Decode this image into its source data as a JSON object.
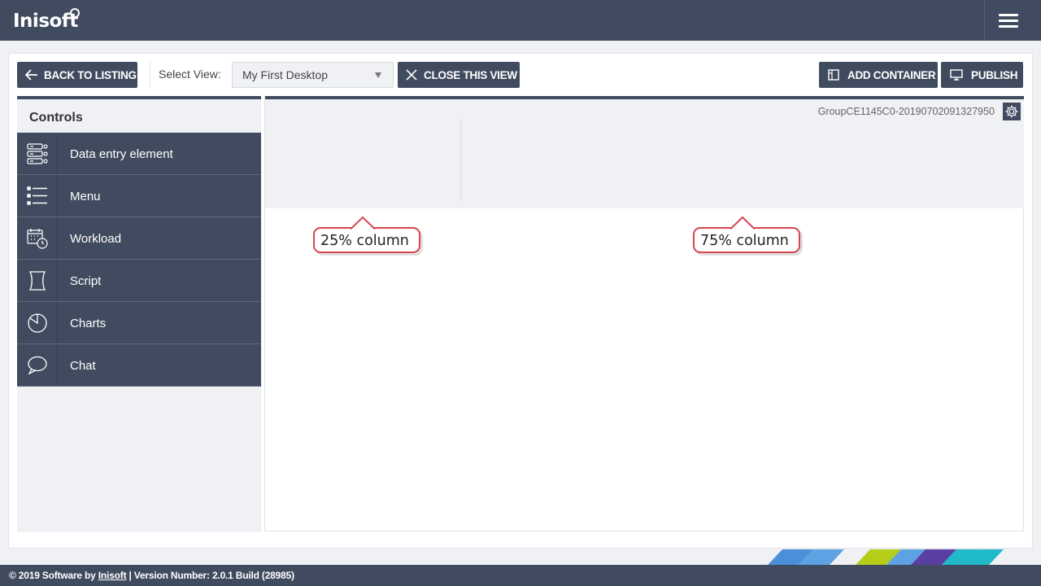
{
  "app": {
    "logo_text": "Inisoft"
  },
  "toolbar": {
    "back_label": "BACK TO LISTING",
    "select_label": "Select View:",
    "select_value": "My First Desktop",
    "close_label": "CLOSE THIS VIEW",
    "add_container_label": "ADD CONTAINER",
    "publish_label": "PUBLISH"
  },
  "controls": {
    "title": "Controls",
    "items": [
      {
        "label": "Data entry element",
        "icon": "data-entry-icon"
      },
      {
        "label": "Menu",
        "icon": "menu-list-icon"
      },
      {
        "label": "Workload",
        "icon": "workload-calendar-icon"
      },
      {
        "label": "Script",
        "icon": "script-icon"
      },
      {
        "label": "Charts",
        "icon": "pie-chart-icon"
      },
      {
        "label": "Chat",
        "icon": "chat-bubble-icon"
      }
    ]
  },
  "canvas": {
    "group_name": "GroupCE1145C0-20190702091327950",
    "callouts": {
      "left": "25% column",
      "right": "75% column"
    }
  },
  "footer": {
    "prefix": "© 2019 Software by ",
    "link": "Inisoft",
    "suffix": " | Version Number: 2.0.1 Build (28985)"
  },
  "colors": {
    "dark": "#414b5f",
    "background": "#f0f1f5",
    "callout_border": "#d64550"
  }
}
